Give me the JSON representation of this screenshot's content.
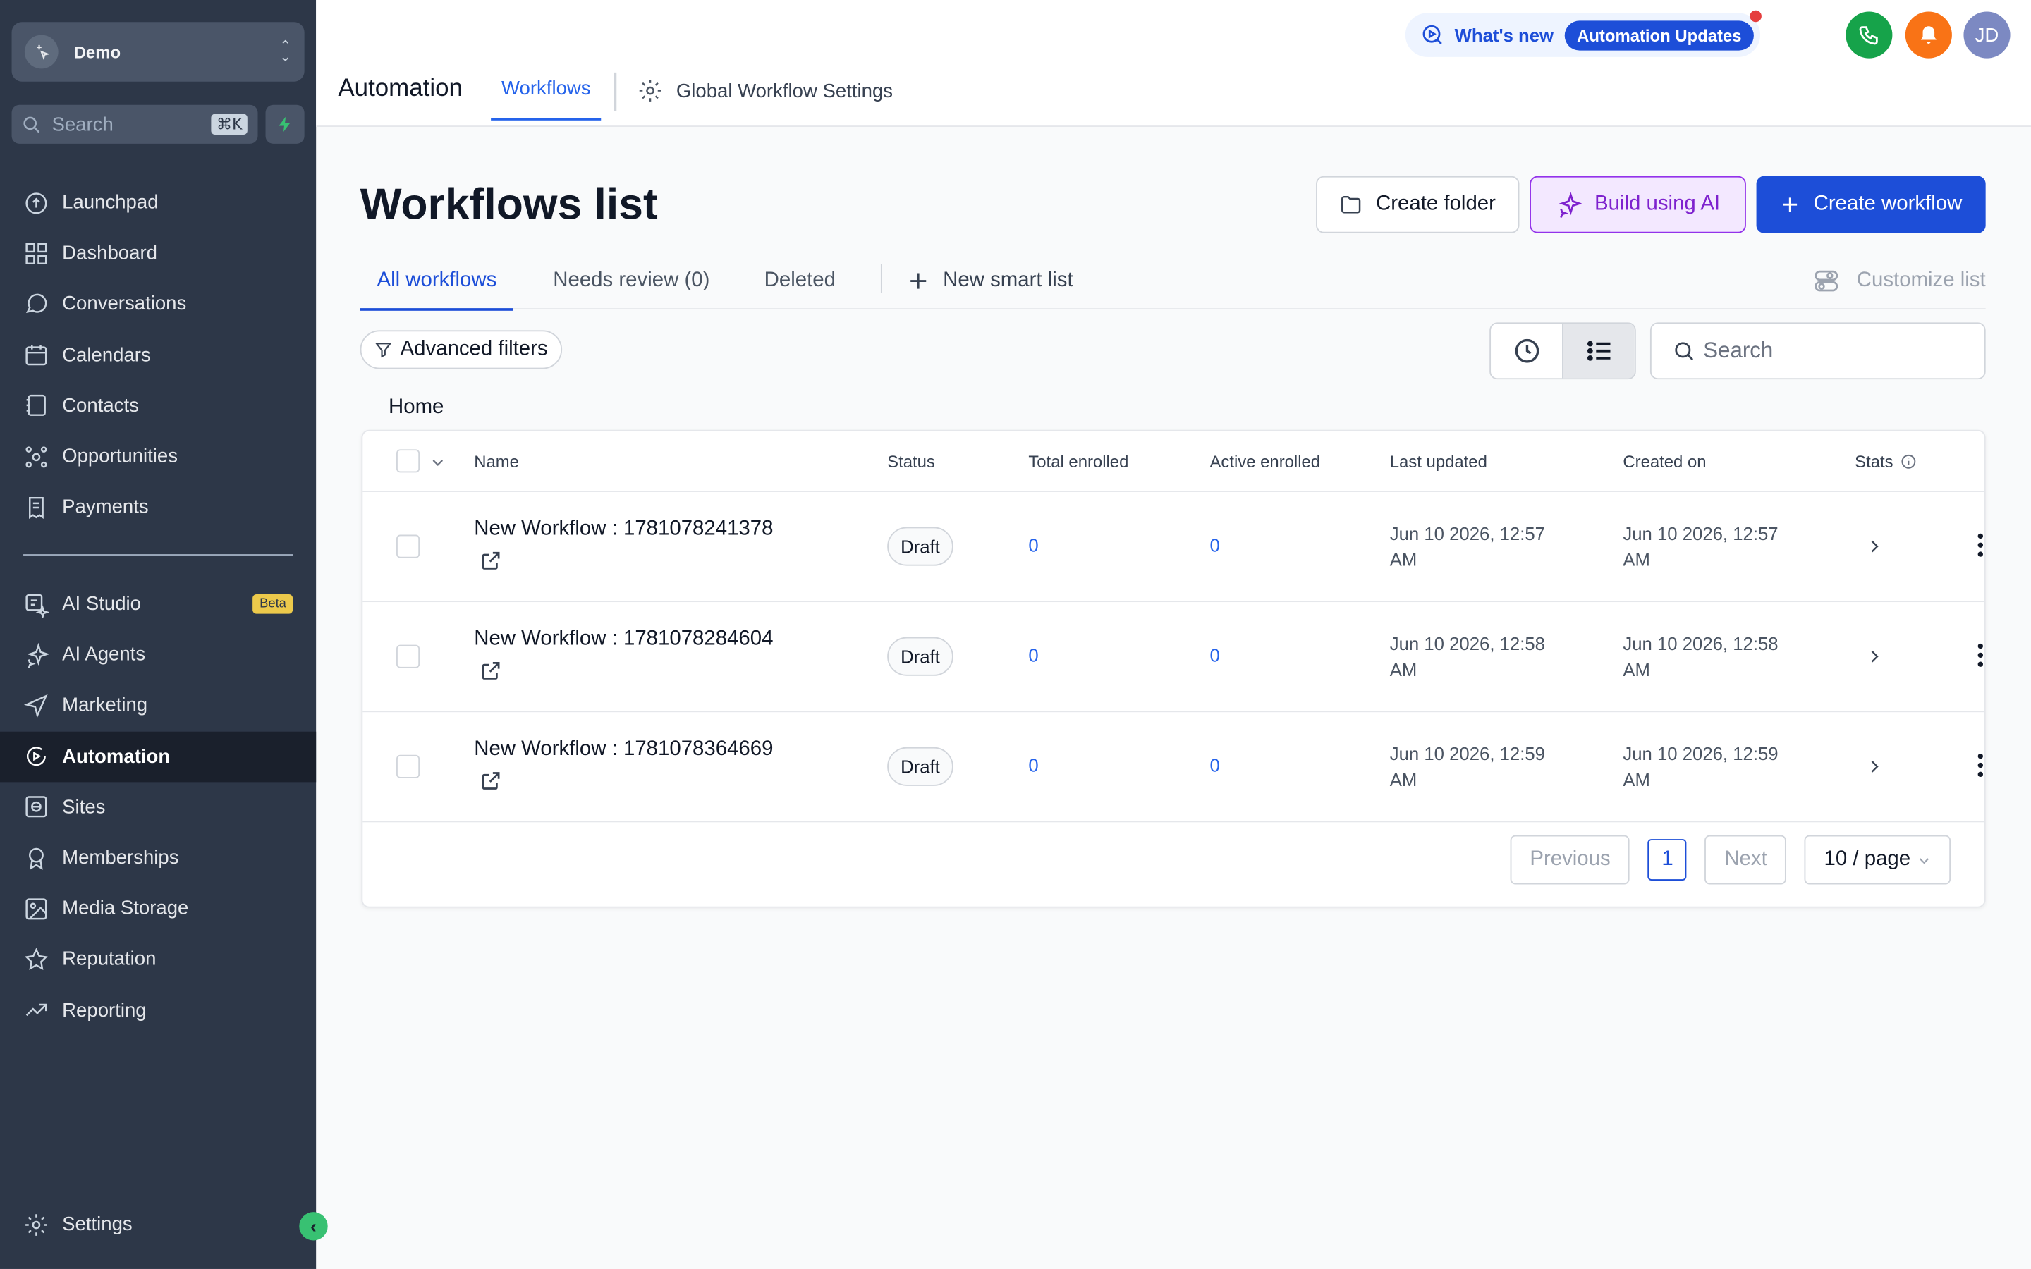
{
  "account": {
    "name": "Demo"
  },
  "sidebar": {
    "search_label": "Search",
    "search_shortcut": "⌘K",
    "items_top": [
      {
        "label": "Launchpad",
        "icon": "launchpad-icon"
      },
      {
        "label": "Dashboard",
        "icon": "dashboard-icon"
      },
      {
        "label": "Conversations",
        "icon": "chat-icon"
      },
      {
        "label": "Calendars",
        "icon": "calendar-icon"
      },
      {
        "label": "Contacts",
        "icon": "contacts-icon"
      },
      {
        "label": "Opportunities",
        "icon": "opportunities-icon"
      },
      {
        "label": "Payments",
        "icon": "payments-icon"
      }
    ],
    "items_bottom": [
      {
        "label": "AI Studio",
        "icon": "ai-studio-icon",
        "badge": "Beta"
      },
      {
        "label": "AI Agents",
        "icon": "sparkle-icon"
      },
      {
        "label": "Marketing",
        "icon": "send-icon"
      },
      {
        "label": "Automation",
        "icon": "automation-icon",
        "active": true
      },
      {
        "label": "Sites",
        "icon": "globe-icon"
      },
      {
        "label": "Memberships",
        "icon": "badge-icon"
      },
      {
        "label": "Media Storage",
        "icon": "image-icon"
      },
      {
        "label": "Reputation",
        "icon": "star-icon"
      },
      {
        "label": "Reporting",
        "icon": "trend-icon"
      }
    ],
    "settings_label": "Settings"
  },
  "header": {
    "whats_new": "What's new",
    "updates_pill": "Automation Updates",
    "avatar_initials": "JD",
    "app_title": "Automation",
    "tab_workflows": "Workflows",
    "tab_global_settings": "Global Workflow Settings"
  },
  "page": {
    "title": "Workflows list",
    "create_folder": "Create folder",
    "build_ai": "Build using AI",
    "create_workflow": "Create workflow",
    "tabs": {
      "all": "All workflows",
      "needs_review": "Needs review (0)",
      "deleted": "Deleted",
      "new_smart_list": "New smart list"
    },
    "customize_list": "Customize list",
    "advanced_filters": "Advanced filters",
    "search_placeholder": "Search",
    "breadcrumb": "Home"
  },
  "table": {
    "headers": {
      "name": "Name",
      "status": "Status",
      "total_enrolled": "Total enrolled",
      "active_enrolled": "Active enrolled",
      "last_updated": "Last updated",
      "created_on": "Created on",
      "stats": "Stats"
    },
    "rows": [
      {
        "name": "New Workflow : 1781078241378",
        "status": "Draft",
        "total": "0",
        "active": "0",
        "updated_1": "Jun 10 2026, 12:57",
        "updated_2": "AM",
        "created_1": "Jun 10 2026, 12:57",
        "created_2": "AM"
      },
      {
        "name": "New Workflow : 1781078284604",
        "status": "Draft",
        "total": "0",
        "active": "0",
        "updated_1": "Jun 10 2026, 12:58",
        "updated_2": "AM",
        "created_1": "Jun 10 2026, 12:58",
        "created_2": "AM"
      },
      {
        "name": "New Workflow : 1781078364669",
        "status": "Draft",
        "total": "0",
        "active": "0",
        "updated_1": "Jun 10 2026, 12:59",
        "updated_2": "AM",
        "created_1": "Jun 10 2026, 12:59",
        "created_2": "AM"
      }
    ]
  },
  "pagination": {
    "previous": "Previous",
    "current": "1",
    "next": "Next",
    "page_size": "10 / page"
  },
  "colors": {
    "sidebar_bg": "#2d3748",
    "accent": "#1d4ed8",
    "ai_accent": "#7e22ce",
    "phone": "#16a34a",
    "bell": "#f97316",
    "avatar": "#7c89c2"
  }
}
